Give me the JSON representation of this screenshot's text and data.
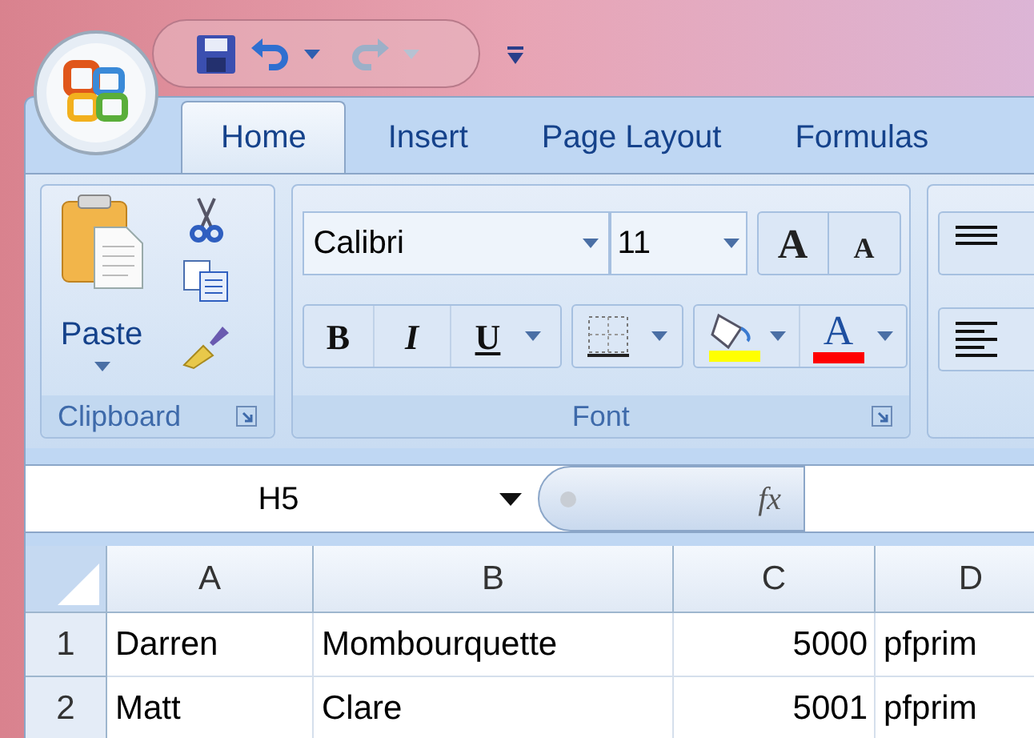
{
  "tabs": [
    {
      "label": "Home",
      "selected": true
    },
    {
      "label": "Insert",
      "selected": false
    },
    {
      "label": "Page Layout",
      "selected": false
    },
    {
      "label": "Formulas",
      "selected": false
    }
  ],
  "clipboard": {
    "paste_label": "Paste",
    "group_label": "Clipboard"
  },
  "font": {
    "font_name": "Calibri",
    "font_size": "11",
    "grow_glyph": "A",
    "shrink_glyph": "A",
    "bold_glyph": "B",
    "italic_glyph": "I",
    "underline_glyph": "U",
    "color_glyph": "A",
    "group_label": "Font"
  },
  "formula_bar": {
    "name_box": "H5",
    "fx_glyph": "fx"
  },
  "sheet": {
    "columns": [
      {
        "label": "A",
        "kind": "text"
      },
      {
        "label": "B",
        "kind": "text"
      },
      {
        "label": "C",
        "kind": "number"
      },
      {
        "label": "D",
        "kind": "text"
      }
    ],
    "rows": [
      {
        "header": "1",
        "cells": [
          "Darren",
          "Mombourquette",
          "5000",
          "pfprim"
        ]
      },
      {
        "header": "2",
        "cells": [
          "Matt",
          "Clare",
          "5001",
          "pfprim"
        ]
      }
    ]
  }
}
